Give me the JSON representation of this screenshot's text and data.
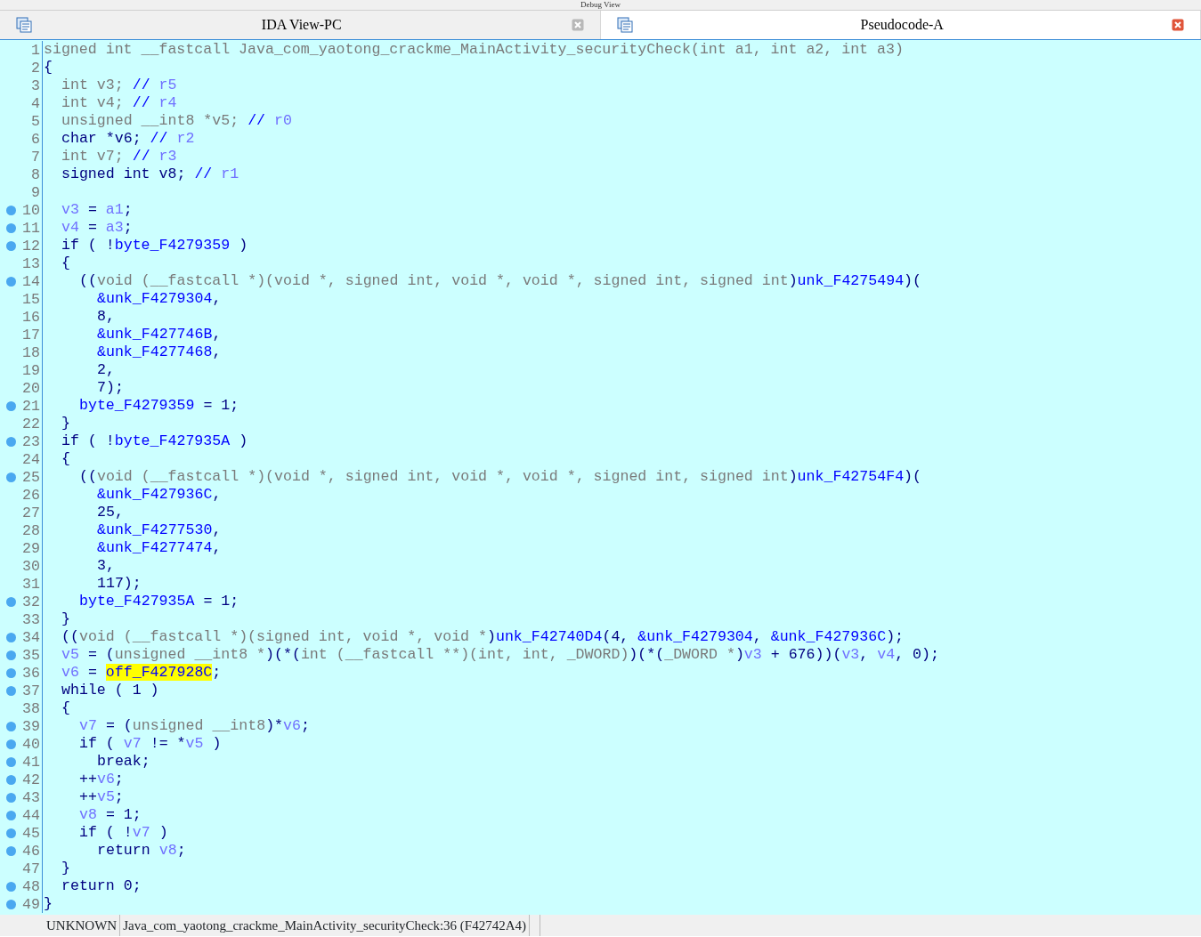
{
  "top_tab": {
    "title": "Debug View"
  },
  "tabs": [
    {
      "title": "IDA View-PC",
      "selected": false
    },
    {
      "title": "Pseudocode-A",
      "selected": true
    }
  ],
  "editor": {
    "lines": [
      {
        "number": "1",
        "breakpoint": false,
        "tokens": [
          {
            "kind": "type",
            "text": "signed int __fastcall Java_com_yaotong_crackme_MainActivity_securityCheck(int a1, int a2, int a3)"
          }
        ]
      },
      {
        "number": "2",
        "breakpoint": false,
        "tokens": [
          {
            "kind": "code",
            "text": "{"
          }
        ],
        "children": [
          {
            "number": "3",
            "breakpoint": false,
            "tokens": [
              {
                "kind": "type",
                "text": "int v3; "
              },
              {
                "kind": "comment",
                "text": "// "
              },
              {
                "kind": "local",
                "text": "r5"
              }
            ]
          },
          {
            "number": "4",
            "breakpoint": false,
            "tokens": [
              {
                "kind": "type",
                "text": "int v4; "
              },
              {
                "kind": "comment",
                "text": "// "
              },
              {
                "kind": "local",
                "text": "r4"
              }
            ]
          },
          {
            "number": "5",
            "breakpoint": false,
            "tokens": [
              {
                "kind": "type",
                "text": "unsigned __int8 *v5; "
              },
              {
                "kind": "comment",
                "text": "// "
              },
              {
                "kind": "local",
                "text": "r0"
              }
            ]
          },
          {
            "number": "6",
            "breakpoint": false,
            "tokens": [
              {
                "kind": "code",
                "text": "char *v6; "
              },
              {
                "kind": "comment",
                "text": "// "
              },
              {
                "kind": "local",
                "text": "r2"
              }
            ]
          },
          {
            "number": "7",
            "breakpoint": false,
            "tokens": [
              {
                "kind": "type",
                "text": "int v7; "
              },
              {
                "kind": "comment",
                "text": "// "
              },
              {
                "kind": "local",
                "text": "r3"
              }
            ]
          },
          {
            "number": "8",
            "breakpoint": false,
            "tokens": [
              {
                "kind": "code",
                "text": "signed int v8; "
              },
              {
                "kind": "comment",
                "text": "// "
              },
              {
                "kind": "local",
                "text": "r1"
              }
            ]
          },
          {
            "number": "9",
            "breakpoint": false
          },
          {
            "number": "10",
            "breakpoint": true,
            "tokens": [
              {
                "kind": "local",
                "text": "v3"
              },
              {
                "kind": "code",
                "text": " = "
              },
              {
                "kind": "local",
                "text": "a1"
              },
              {
                "kind": "code",
                "text": ";"
              }
            ]
          },
          {
            "number": "11",
            "breakpoint": true,
            "tokens": [
              {
                "kind": "local",
                "text": "v4"
              },
              {
                "kind": "code",
                "text": " = "
              },
              {
                "kind": "local",
                "text": "a3"
              },
              {
                "kind": "code",
                "text": ";"
              }
            ]
          },
          {
            "number": "12",
            "breakpoint": true,
            "tokens": [
              {
                "kind": "code",
                "text": "if ( !"
              },
              {
                "kind": "global",
                "text": "byte_F4279359"
              },
              {
                "kind": "code",
                "text": " )"
              }
            ]
          },
          {
            "number": "13",
            "breakpoint": false,
            "tokens": [
              {
                "kind": "code",
                "text": "{"
              }
            ],
            "children": [
              {
                "number": "14",
                "breakpoint": true,
                "tokens": [
                  {
                    "kind": "code",
                    "text": "(("
                  },
                  {
                    "kind": "type",
                    "text": "void (__fastcall *)(void *, signed int, void *, void *, signed int, signed int"
                  },
                  {
                    "kind": "code",
                    "text": ")"
                  },
                  {
                    "kind": "global",
                    "text": "unk_F4275494"
                  },
                  {
                    "kind": "code",
                    "text": ")("
                  }
                ],
                "children": [
                  {
                    "number": "15",
                    "breakpoint": false,
                    "tokens": [
                      {
                        "kind": "global",
                        "text": "&unk_F4279304"
                      },
                      {
                        "kind": "code",
                        "text": ","
                      }
                    ]
                  },
                  {
                    "number": "16",
                    "breakpoint": false,
                    "tokens": [
                      {
                        "kind": "code",
                        "text": "8,"
                      }
                    ]
                  },
                  {
                    "number": "17",
                    "breakpoint": false,
                    "tokens": [
                      {
                        "kind": "global",
                        "text": "&unk_F427746B"
                      },
                      {
                        "kind": "code",
                        "text": ","
                      }
                    ]
                  },
                  {
                    "number": "18",
                    "breakpoint": false,
                    "tokens": [
                      {
                        "kind": "global",
                        "text": "&unk_F4277468"
                      },
                      {
                        "kind": "code",
                        "text": ","
                      }
                    ]
                  },
                  {
                    "number": "19",
                    "breakpoint": false,
                    "tokens": [
                      {
                        "kind": "code",
                        "text": "2,"
                      }
                    ]
                  },
                  {
                    "number": "20",
                    "breakpoint": false,
                    "tokens": [
                      {
                        "kind": "code",
                        "text": "7);"
                      }
                    ]
                  }
                ]
              },
              {
                "number": "21",
                "breakpoint": true,
                "tokens": [
                  {
                    "kind": "global",
                    "text": "byte_F4279359"
                  },
                  {
                    "kind": "code",
                    "text": " = 1;"
                  }
                ]
              }
            ]
          },
          {
            "number": "22",
            "breakpoint": false,
            "tokens": [
              {
                "kind": "code",
                "text": "}"
              }
            ]
          },
          {
            "number": "23",
            "breakpoint": true,
            "tokens": [
              {
                "kind": "code",
                "text": "if ( !"
              },
              {
                "kind": "global",
                "text": "byte_F427935A"
              },
              {
                "kind": "code",
                "text": " )"
              }
            ]
          },
          {
            "number": "24",
            "breakpoint": false,
            "tokens": [
              {
                "kind": "code",
                "text": "{"
              }
            ],
            "children": [
              {
                "number": "25",
                "breakpoint": true,
                "tokens": [
                  {
                    "kind": "code",
                    "text": "(("
                  },
                  {
                    "kind": "type",
                    "text": "void (__fastcall *)(void *, signed int, void *, void *, signed int, signed int"
                  },
                  {
                    "kind": "code",
                    "text": ")"
                  },
                  {
                    "kind": "global",
                    "text": "unk_F42754F4"
                  },
                  {
                    "kind": "code",
                    "text": ")("
                  }
                ],
                "children": [
                  {
                    "number": "26",
                    "breakpoint": false,
                    "tokens": [
                      {
                        "kind": "global",
                        "text": "&unk_F427936C"
                      },
                      {
                        "kind": "code",
                        "text": ","
                      }
                    ]
                  },
                  {
                    "number": "27",
                    "breakpoint": false,
                    "tokens": [
                      {
                        "kind": "code",
                        "text": "25,"
                      }
                    ]
                  },
                  {
                    "number": "28",
                    "breakpoint": false,
                    "tokens": [
                      {
                        "kind": "global",
                        "text": "&unk_F4277530"
                      },
                      {
                        "kind": "code",
                        "text": ","
                      }
                    ]
                  },
                  {
                    "number": "29",
                    "breakpoint": false,
                    "tokens": [
                      {
                        "kind": "global",
                        "text": "&unk_F4277474"
                      },
                      {
                        "kind": "code",
                        "text": ","
                      }
                    ]
                  },
                  {
                    "number": "30",
                    "breakpoint": false,
                    "tokens": [
                      {
                        "kind": "code",
                        "text": "3,"
                      }
                    ]
                  },
                  {
                    "number": "31",
                    "breakpoint": false,
                    "tokens": [
                      {
                        "kind": "code",
                        "text": "117);"
                      }
                    ]
                  }
                ]
              },
              {
                "number": "32",
                "breakpoint": true,
                "tokens": [
                  {
                    "kind": "global",
                    "text": "byte_F427935A"
                  },
                  {
                    "kind": "code",
                    "text": " = 1;"
                  }
                ]
              }
            ]
          },
          {
            "number": "33",
            "breakpoint": false,
            "tokens": [
              {
                "kind": "code",
                "text": "}"
              }
            ]
          },
          {
            "number": "34",
            "breakpoint": true,
            "tokens": [
              {
                "kind": "code",
                "text": "(("
              },
              {
                "kind": "type",
                "text": "void (__fastcall *)(signed int, void *, void *"
              },
              {
                "kind": "code",
                "text": ")"
              },
              {
                "kind": "global",
                "text": "unk_F42740D4"
              },
              {
                "kind": "code",
                "text": "(4, "
              },
              {
                "kind": "global",
                "text": "&unk_F4279304"
              },
              {
                "kind": "code",
                "text": ", "
              },
              {
                "kind": "global",
                "text": "&unk_F427936C"
              },
              {
                "kind": "code",
                "text": ");"
              }
            ]
          },
          {
            "number": "35",
            "breakpoint": true,
            "tokens": [
              {
                "kind": "local",
                "text": "v5"
              },
              {
                "kind": "code",
                "text": " = ("
              },
              {
                "kind": "type",
                "text": "unsigned __int8 *"
              },
              {
                "kind": "code",
                "text": ")(*("
              },
              {
                "kind": "type",
                "text": "int (__fastcall **)(int, int, _DWORD)"
              },
              {
                "kind": "code",
                "text": ")(*("
              },
              {
                "kind": "type",
                "text": "_DWORD *"
              },
              {
                "kind": "code",
                "text": ")"
              },
              {
                "kind": "local",
                "text": "v3"
              },
              {
                "kind": "code",
                "text": " + 676))("
              },
              {
                "kind": "local",
                "text": "v3"
              },
              {
                "kind": "code",
                "text": ", "
              },
              {
                "kind": "local",
                "text": "v4"
              },
              {
                "kind": "code",
                "text": ", 0);"
              }
            ]
          },
          {
            "number": "36",
            "breakpoint": true,
            "tokens": [
              {
                "kind": "local",
                "text": "v6"
              },
              {
                "kind": "code",
                "text": " = "
              },
              {
                "kind": "highlight",
                "text": "off_F427928C"
              },
              {
                "kind": "code",
                "text": ";"
              }
            ]
          },
          {
            "number": "37",
            "breakpoint": true,
            "tokens": [
              {
                "kind": "code",
                "text": "while ( 1 )"
              }
            ]
          },
          {
            "number": "38",
            "breakpoint": false,
            "tokens": [
              {
                "kind": "code",
                "text": "{"
              }
            ],
            "children": [
              {
                "number": "39",
                "breakpoint": true,
                "tokens": [
                  {
                    "kind": "local",
                    "text": "v7"
                  },
                  {
                    "kind": "code",
                    "text": " = ("
                  },
                  {
                    "kind": "type",
                    "text": "unsigned __int8"
                  },
                  {
                    "kind": "code",
                    "text": ")*"
                  },
                  {
                    "kind": "local",
                    "text": "v6"
                  },
                  {
                    "kind": "code",
                    "text": ";"
                  }
                ]
              },
              {
                "number": "40",
                "breakpoint": true,
                "tokens": [
                  {
                    "kind": "code",
                    "text": "if ( "
                  },
                  {
                    "kind": "local",
                    "text": "v7"
                  },
                  {
                    "kind": "code",
                    "text": " != *"
                  },
                  {
                    "kind": "local",
                    "text": "v5"
                  },
                  {
                    "kind": "code",
                    "text": " )"
                  }
                ],
                "children": [
                  {
                    "number": "41",
                    "breakpoint": true,
                    "tokens": [
                      {
                        "kind": "code",
                        "text": "break;"
                      }
                    ]
                  }
                ]
              },
              {
                "number": "42",
                "breakpoint": true,
                "tokens": [
                  {
                    "kind": "code",
                    "text": "++"
                  },
                  {
                    "kind": "local",
                    "text": "v6"
                  },
                  {
                    "kind": "code",
                    "text": ";"
                  }
                ]
              },
              {
                "number": "43",
                "breakpoint": true,
                "tokens": [
                  {
                    "kind": "code",
                    "text": "++"
                  },
                  {
                    "kind": "local",
                    "text": "v5"
                  },
                  {
                    "kind": "code",
                    "text": ";"
                  }
                ]
              },
              {
                "number": "44",
                "breakpoint": true,
                "tokens": [
                  {
                    "kind": "local",
                    "text": "v8"
                  },
                  {
                    "kind": "code",
                    "text": " = 1;"
                  }
                ]
              },
              {
                "number": "45",
                "breakpoint": true,
                "tokens": [
                  {
                    "kind": "code",
                    "text": "if ( !"
                  },
                  {
                    "kind": "local",
                    "text": "v7"
                  },
                  {
                    "kind": "code",
                    "text": " )"
                  }
                ],
                "children": [
                  {
                    "number": "46",
                    "breakpoint": true,
                    "tokens": [
                      {
                        "kind": "code",
                        "text": "return "
                      },
                      {
                        "kind": "local",
                        "text": "v8"
                      },
                      {
                        "kind": "code",
                        "text": ";"
                      }
                    ]
                  }
                ]
              }
            ]
          },
          {
            "number": "47",
            "breakpoint": false,
            "tokens": [
              {
                "kind": "code",
                "text": "}"
              }
            ]
          },
          {
            "number": "48",
            "breakpoint": true,
            "tokens": [
              {
                "kind": "code",
                "text": "return 0;"
              }
            ]
          }
        ]
      },
      {
        "number": "49",
        "breakpoint": true,
        "tokens": [
          {
            "kind": "code",
            "text": "}"
          }
        ]
      }
    ]
  },
  "status_bar": [
    "UNKNOWN",
    "Java_com_yaotong_crackme_MainActivity_securityCheck:36 (F42742A4)"
  ]
}
